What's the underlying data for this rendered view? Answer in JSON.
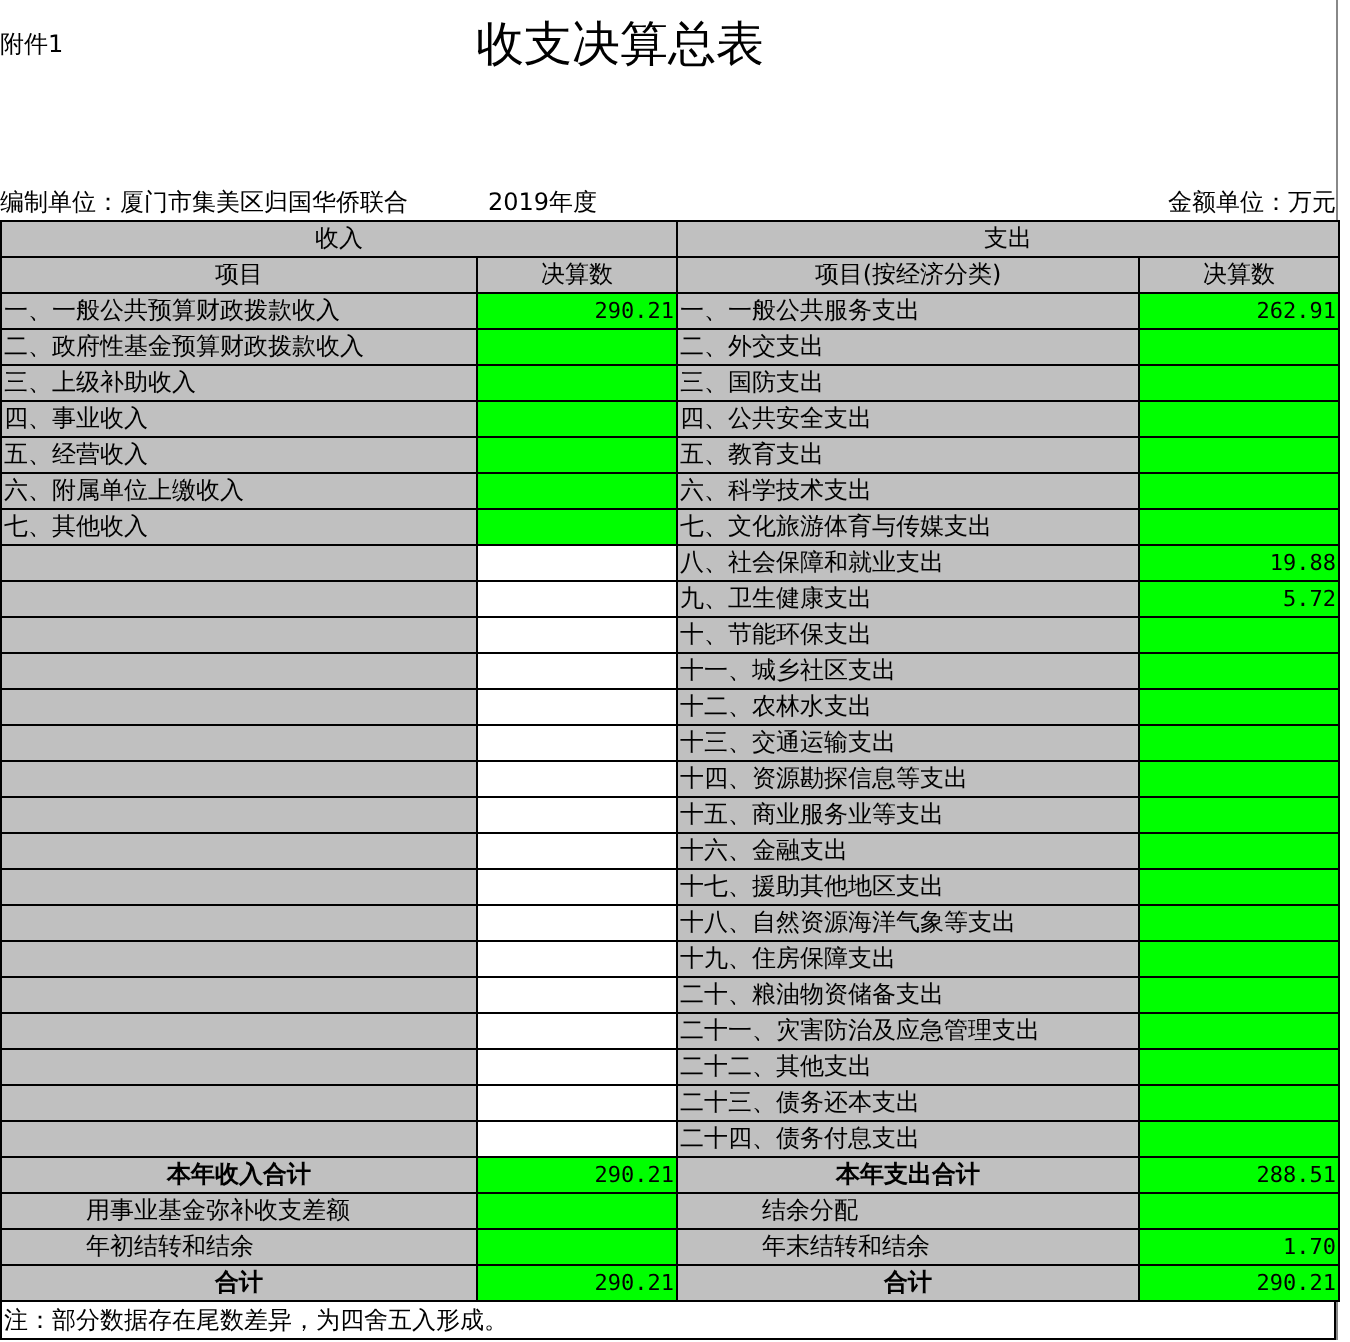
{
  "attachment": "附件1",
  "title": "收支决算总表",
  "unit": "编制单位：厦门市集美区归国华侨联合",
  "year": "2019年度",
  "currency": "金额单位：万元",
  "income_header": "收入",
  "expense_header": "支出",
  "columns": [
    "项目",
    "决算数",
    "项目(按经济分类)",
    "决算数"
  ],
  "income": [
    {
      "label": "一、一般公共预算财政拨款收入",
      "amount": "290.21"
    },
    {
      "label": "二、政府性基金预算财政拨款收入"
    },
    {
      "label": "三、上级补助收入"
    },
    {
      "label": "四、事业收入"
    },
    {
      "label": "五、经营收入"
    },
    {
      "label": "六、附属单位上缴收入"
    },
    {
      "label": "七、其他收入"
    }
  ],
  "expense": [
    {
      "label": "一、一般公共服务支出",
      "amount": "262.91"
    },
    {
      "label": "二、外交支出"
    },
    {
      "label": "三、国防支出"
    },
    {
      "label": "四、公共安全支出"
    },
    {
      "label": "五、教育支出"
    },
    {
      "label": "六、科学技术支出"
    },
    {
      "label": "七、文化旅游体育与传媒支出"
    },
    {
      "label": "八、社会保障和就业支出",
      "amount": "19.88"
    },
    {
      "label": "九、卫生健康支出",
      "amount": "5.72"
    },
    {
      "label": "十、节能环保支出"
    },
    {
      "label": "十一、城乡社区支出"
    },
    {
      "label": "十二、农林水支出"
    },
    {
      "label": "十三、交通运输支出"
    },
    {
      "label": "十四、资源勘探信息等支出"
    },
    {
      "label": "十五、商业服务业等支出"
    },
    {
      "label": "十六、金融支出"
    },
    {
      "label": "十七、援助其他地区支出"
    },
    {
      "label": "十八、自然资源海洋气象等支出"
    },
    {
      "label": "十九、住房保障支出"
    },
    {
      "label": "二十、粮油物资储备支出"
    },
    {
      "label": "二十一、灾害防治及应急管理支出"
    },
    {
      "label": "二十二、其他支出"
    },
    {
      "label": "二十三、债务还本支出"
    },
    {
      "label": "二十四、债务付息支出"
    }
  ],
  "summary": [
    {
      "kind": "total",
      "left_label": "本年收入合计",
      "left_amount": "290.21",
      "right_label": "本年支出合计",
      "right_amount": "288.51"
    },
    {
      "kind": "sub",
      "left_label": "用事业基金弥补收支差额",
      "right_label": "结余分配"
    },
    {
      "kind": "sub",
      "left_label": "年初结转和结余",
      "right_label": "年末结转和结余",
      "right_amount": "1.70"
    },
    {
      "kind": "total",
      "left_label": "合计",
      "left_amount": "290.21",
      "right_label": "合计",
      "right_amount": "290.21"
    }
  ],
  "note": "注：部分数据存在尾数差异，为四舍五入形成。"
}
